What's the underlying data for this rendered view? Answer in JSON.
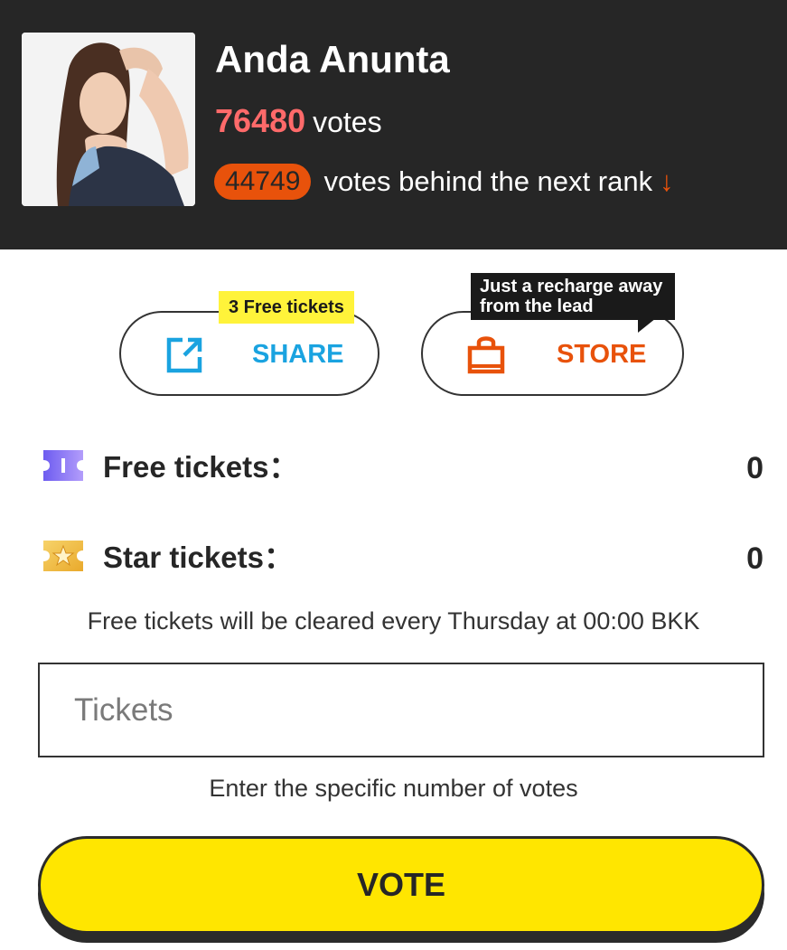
{
  "profile": {
    "name": "Anda Anunta",
    "votes_count": "76480",
    "votes_word": "votes",
    "gap_to_next": "44749",
    "behind_text": "votes behind the next rank",
    "trend_arrow": "↓"
  },
  "actions": {
    "share_label": "SHARE",
    "share_tag": "3 Free tickets",
    "store_label": "STORE",
    "store_tag": "Just a recharge away from the lead"
  },
  "tickets": {
    "free_label": "Free tickets：",
    "free_value": "0",
    "star_label": "Star tickets：",
    "star_value": "0",
    "notice": "Free tickets will be cleared every Thursday at 00:00 BKK"
  },
  "vote_form": {
    "input_placeholder": "Tickets",
    "input_value": "",
    "hint": "Enter the specific number of votes",
    "vote_label": "VOTE"
  },
  "colors": {
    "header_bg": "#262626",
    "votes_accent": "#ff6a6a",
    "badge_orange": "#e8520b",
    "share_blue": "#1aa3e0",
    "vote_yellow": "#ffe600",
    "tag_yellow": "#fff33a",
    "free_ticket_purple": "#8b6cf2",
    "star_ticket_gold": "#f5c542"
  },
  "icons": {
    "share": "share-icon",
    "store": "shopping-bag-icon",
    "free_ticket": "ticket-icon",
    "star_ticket": "star-ticket-icon"
  }
}
